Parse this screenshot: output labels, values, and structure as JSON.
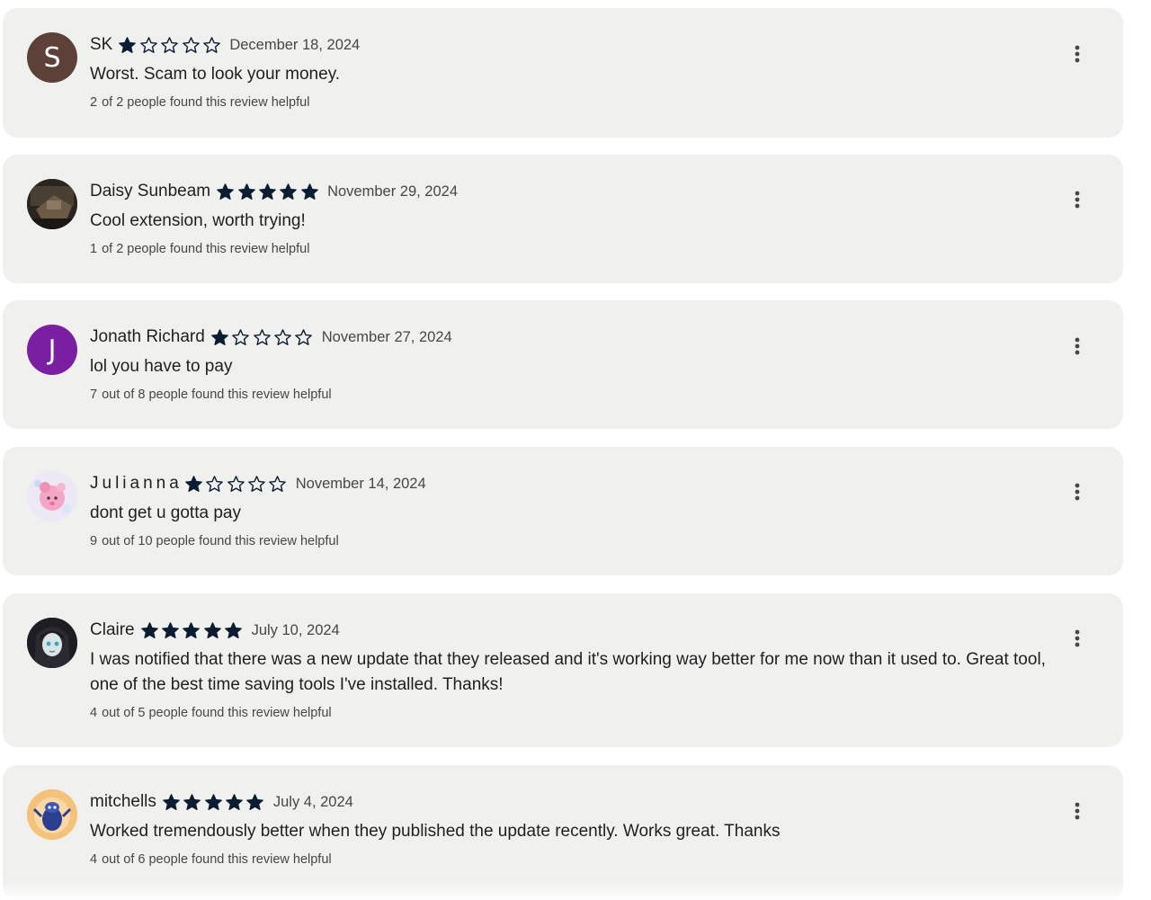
{
  "reviews": [
    {
      "name": "SK",
      "avatar_letter": "S",
      "avatar_color": "#5d4037",
      "rating": 1,
      "date": "December 18, 2024",
      "text": "Worst. Scam to look your money.",
      "helpful_count": "2",
      "helpful_rest": "of 2 people found this review helpful"
    },
    {
      "name": "Daisy Sunbeam",
      "avatar_letter": "",
      "avatar_color": "#3a3228",
      "rating": 5,
      "date": "November 29, 2024",
      "text": "Cool extension, worth trying!",
      "helpful_count": "1",
      "helpful_rest": "of 2 people found this review helpful"
    },
    {
      "name": "Jonath Richard",
      "avatar_letter": "J",
      "avatar_color": "#7b1fa2",
      "rating": 1,
      "date": "November 27, 2024",
      "text": "lol you have to pay",
      "helpful_count": "7",
      "helpful_rest": "out of 8 people found this review helpful"
    },
    {
      "name": "Julianna",
      "avatar_letter": "",
      "avatar_color": "#e8e4f4",
      "rating": 1,
      "date": "November 14, 2024",
      "text": "dont get u gotta pay",
      "helpful_count": "9",
      "helpful_rest": "out of 10 people found this review helpful"
    },
    {
      "name": "Claire",
      "avatar_letter": "",
      "avatar_color": "#1e1e22",
      "rating": 5,
      "date": "July 10, 2024",
      "text": "I was notified that there was a new update that they released and it's working way better for me now than it used to. Great tool, one of the best time saving tools I've installed. Thanks!",
      "helpful_count": "4",
      "helpful_rest": "out of 5 people found this review helpful"
    },
    {
      "name": "mitchells",
      "avatar_letter": "",
      "avatar_color": "#f4c27a",
      "rating": 5,
      "date": "July 4, 2024",
      "text": "Worked tremendously better when they published the update recently. Works great. Thanks",
      "helpful_count": "4",
      "helpful_rest": "out of 6 people found this review helpful"
    }
  ],
  "colors": {
    "card_background": "#f0f1ef",
    "star_fill": "#0b1d33",
    "text": "#1f1f1f",
    "secondary_text": "#444746"
  },
  "icons": {
    "star_filled": "star-filled-icon",
    "star_empty": "star-outline-icon",
    "menu": "more-vert-icon"
  }
}
